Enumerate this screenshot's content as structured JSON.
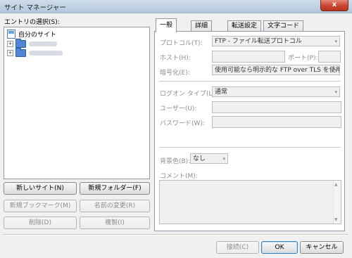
{
  "window": {
    "title": "サイト マネージャー",
    "close_glyph": "x"
  },
  "left": {
    "select_label": "エントリの選択(S):",
    "tree_root": "自分のサイト",
    "buttons": {
      "new_site": "新しいサイト(N)",
      "new_folder": "新規フォルダー(F)",
      "new_bookmark": "新規ブックマーク(M)",
      "rename": "名前の変更(R)",
      "delete": "削除(D)",
      "duplicate": "複製(I)"
    }
  },
  "tabs": [
    "一般",
    "詳細",
    "転送設定",
    "文字コード"
  ],
  "general": {
    "protocol_label": "プロトコル(T):",
    "protocol_value": "FTP - ファイル転送プロトコル",
    "host_label": "ホスト(H):",
    "host_value": "",
    "port_label": "ポート(P):",
    "port_value": "",
    "encryption_label": "暗号化(E):",
    "encryption_value": "使用可能なら明示的な FTP over TLS を使用",
    "logon_label": "ログオン タイプ(L):",
    "logon_value": "通常",
    "user_label": "ユーザー(U):",
    "user_value": "",
    "password_label": "パスワード(W):",
    "password_value": "",
    "bgcolor_label": "背景色(B):",
    "bgcolor_value": "なし",
    "comment_label": "コメント(M):",
    "comment_value": ""
  },
  "footer": {
    "connect": "接続(C)",
    "ok": "OK",
    "cancel": "キャンセル"
  },
  "icons": {
    "dropdown": "▾",
    "expander": "+",
    "scroll_up": "▲",
    "scroll_down": "▼"
  }
}
